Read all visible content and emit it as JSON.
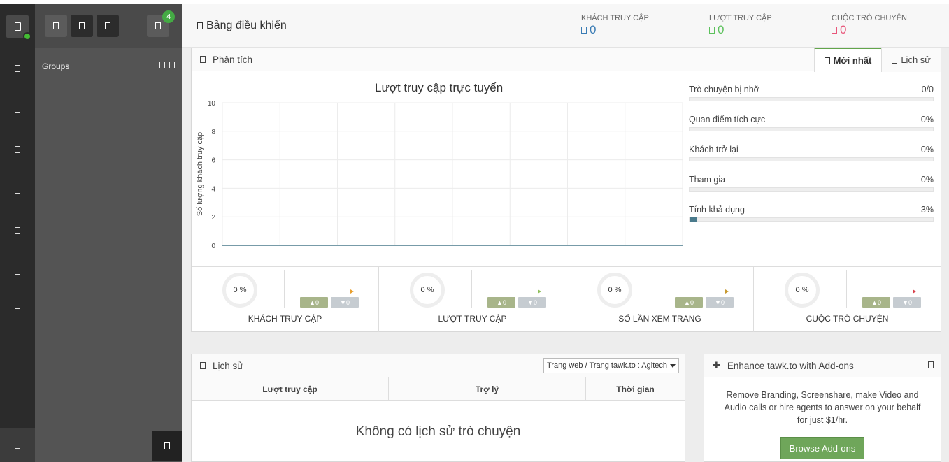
{
  "header": {
    "title": "Bảng điều khiển",
    "stats": [
      {
        "label": "KHÁCH TRUY CẬP",
        "value": "0",
        "color": "#3a7cb5"
      },
      {
        "label": "LƯỢT TRUY CẬP",
        "value": "0",
        "color": "#5cc15c"
      },
      {
        "label": "CUỘC TRÒ CHUYỆN",
        "value": "0",
        "color": "#e8567a"
      }
    ]
  },
  "groups": {
    "label": "Groups",
    "badge": "4"
  },
  "analytics": {
    "title": "Phân tích",
    "tabs": [
      {
        "label": "Mới nhất",
        "active": true
      },
      {
        "label": "Lịch sử",
        "active": false
      }
    ],
    "metrics": [
      {
        "label": "Trò chuyện bị nhỡ",
        "value": "0/0",
        "fill": 0
      },
      {
        "label": "Quan điểm tích cực",
        "value": "0%",
        "fill": 0
      },
      {
        "label": "Khách trở lại",
        "value": "0%",
        "fill": 0
      },
      {
        "label": "Tham gia",
        "value": "0%",
        "fill": 0
      },
      {
        "label": "Tính khả dụng",
        "value": "3%",
        "fill": 0.03
      }
    ],
    "kpis": [
      {
        "percent": "0 %",
        "up": "▲0",
        "down": "▼0",
        "label": "KHÁCH TRUY CẬP",
        "trend_color": "#e8a030"
      },
      {
        "percent": "0 %",
        "up": "▲0",
        "down": "▼0",
        "label": "LƯỢT TRUY CẬP",
        "trend_color": "#8fbf5a"
      },
      {
        "percent": "0 %",
        "up": "▲0",
        "down": "▼0",
        "label": "SỐ LẦN XEM TRANG",
        "trend_color": "#c89a30"
      },
      {
        "percent": "0 %",
        "up": "▲0",
        "down": "▼0",
        "label": "CUỘC TRÒ CHUYỆN",
        "trend_color": "#d8404a"
      }
    ]
  },
  "chart_data": {
    "type": "line",
    "title": "Lượt truy cập trực tuyến",
    "ylabel": "Số lượng khách truy cập",
    "xlabel": "",
    "ylim": [
      0,
      10
    ],
    "yticks": [
      "0",
      "2",
      "4",
      "6",
      "8",
      "10"
    ],
    "series": [
      {
        "values": [
          0,
          0,
          0,
          0,
          0,
          0,
          0,
          0,
          0
        ]
      }
    ],
    "grid": true,
    "line_color": "#4a7a8c"
  },
  "history": {
    "title": "Lịch sử",
    "filter": "Trang web / Trang tawk.to : Agitech",
    "columns": [
      "Lượt truy cập",
      "Trợ lý",
      "Thời gian"
    ],
    "empty": "Không có lịch sử trò chuyện"
  },
  "addons": {
    "title": "Enhance tawk.to with Add-ons",
    "description": "Remove Branding, Screenshare, make Video and Audio calls or hire agents to answer on your behalf for just $1/hr.",
    "button": "Browse Add-ons",
    "button_color": "#6fa65a"
  }
}
